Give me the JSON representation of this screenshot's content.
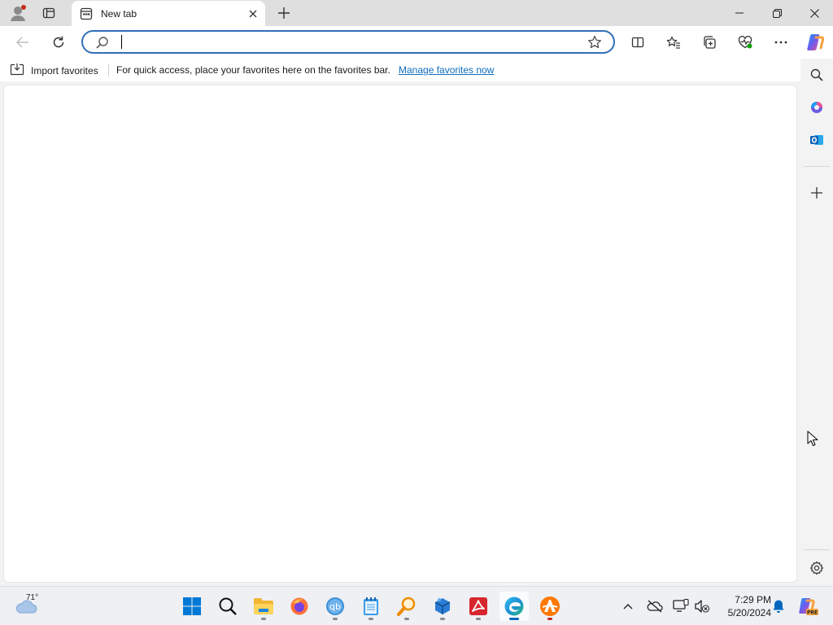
{
  "browser": {
    "tab": {
      "title": "New tab"
    },
    "address_bar": {
      "value": "",
      "placeholder": ""
    }
  },
  "favorites_bar": {
    "import_label": "Import favorites",
    "message": "For quick access, place your favorites here on the favorites bar.",
    "manage_link": "Manage favorites now"
  },
  "taskbar": {
    "weather_temp": "71°",
    "time": "7:29 PM",
    "date": "5/20/2024",
    "apps": [
      "start",
      "search",
      "file-explorer",
      "firefox",
      "qbittorrent",
      "notepad",
      "search-app",
      "app-store",
      "pdf-reader",
      "edge",
      "avast"
    ]
  },
  "colors": {
    "accent": "#0067c0",
    "link": "#0f6cbd",
    "address_focus": "#2f6fb6"
  }
}
